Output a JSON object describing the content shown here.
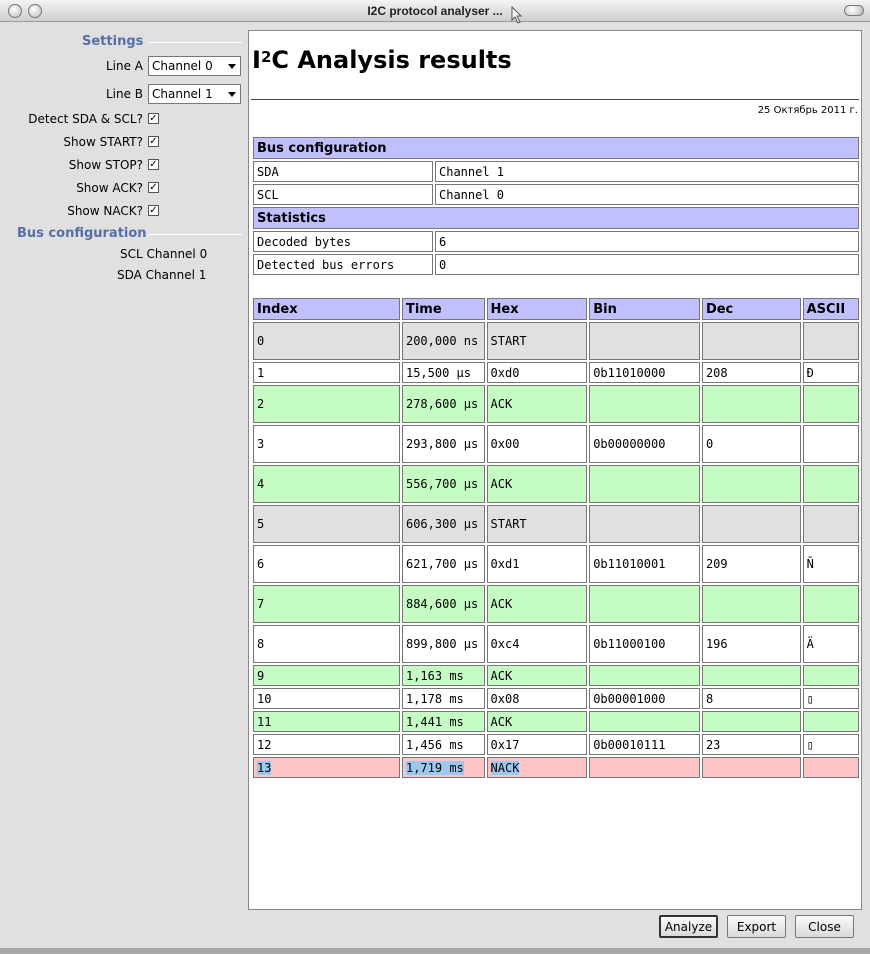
{
  "window": {
    "title": "I2C protocol analyser ..."
  },
  "settings": {
    "heading": "Settings",
    "line_a_label": "Line A",
    "line_a_value": "Channel 0",
    "line_b_label": "Line B",
    "line_b_value": "Channel 1",
    "checks": [
      {
        "label": "Detect SDA & SCL?",
        "checked": true
      },
      {
        "label": "Show START?",
        "checked": true
      },
      {
        "label": "Show STOP?",
        "checked": true
      },
      {
        "label": "Show ACK?",
        "checked": true
      },
      {
        "label": "Show NACK?",
        "checked": true
      }
    ],
    "check_mark": "✓"
  },
  "bus_panel": {
    "heading": "Bus configuration",
    "scl": "SCL Channel 0",
    "sda": "SDA Channel 1"
  },
  "report": {
    "title_i": "I",
    "title_sup": "2",
    "title_rest": "C Analysis results",
    "date": "25 Октябрь 2011 г.",
    "bus_config_heading": "Bus configuration",
    "sda_label": "SDA",
    "sda_value": "Channel 1",
    "scl_label": "SCL",
    "scl_value": "Channel 0",
    "stats_heading": "Statistics",
    "decoded_label": "Decoded bytes",
    "decoded_value": "6",
    "errors_label": "Detected bus errors",
    "errors_value": "0",
    "columns": [
      "Index",
      "Time",
      "Hex",
      "Bin",
      "Dec",
      "ASCII"
    ],
    "rows": [
      {
        "kind": "start",
        "cells": [
          "0",
          "200,000 ns",
          "START",
          "",
          "",
          ""
        ]
      },
      {
        "kind": "data",
        "cells": [
          "1",
          "15,500 µs",
          "0xd0",
          "0b11010000",
          "208",
          "Ð"
        ]
      },
      {
        "kind": "ack",
        "cells": [
          "2",
          "278,600 µs",
          "ACK",
          "",
          "",
          ""
        ]
      },
      {
        "kind": "data",
        "cells": [
          "3",
          "293,800 µs",
          "0x00",
          "0b00000000",
          "0",
          ""
        ]
      },
      {
        "kind": "ack",
        "cells": [
          "4",
          "556,700 µs",
          "ACK",
          "",
          "",
          ""
        ]
      },
      {
        "kind": "start",
        "cells": [
          "5",
          "606,300 µs",
          "START",
          "",
          "",
          ""
        ]
      },
      {
        "kind": "data",
        "cells": [
          "6",
          "621,700 µs",
          "0xd1",
          "0b11010001",
          "209",
          "Ñ"
        ]
      },
      {
        "kind": "ack",
        "cells": [
          "7",
          "884,600 µs",
          "ACK",
          "",
          "",
          ""
        ]
      },
      {
        "kind": "data",
        "cells": [
          "8",
          "899,800 µs",
          "0xc4",
          "0b11000100",
          "196",
          "Ä"
        ]
      },
      {
        "kind": "ack",
        "cells": [
          "9",
          "1,163 ms",
          "ACK",
          "",
          "",
          ""
        ]
      },
      {
        "kind": "data",
        "cells": [
          "10",
          "1,178 ms",
          "0x08",
          "0b00001000",
          "8",
          "▯"
        ]
      },
      {
        "kind": "ack",
        "cells": [
          "11",
          "1,441 ms",
          "ACK",
          "",
          "",
          ""
        ]
      },
      {
        "kind": "data",
        "cells": [
          "12",
          "1,456 ms",
          "0x17",
          "0b00010111",
          "23",
          "▯"
        ]
      },
      {
        "kind": "nack",
        "cells": [
          "13",
          "1,719 ms",
          "NACK",
          "",
          "",
          ""
        ]
      }
    ]
  },
  "buttons": {
    "analyze": "Analyze",
    "export": "Export",
    "close": "Close"
  }
}
